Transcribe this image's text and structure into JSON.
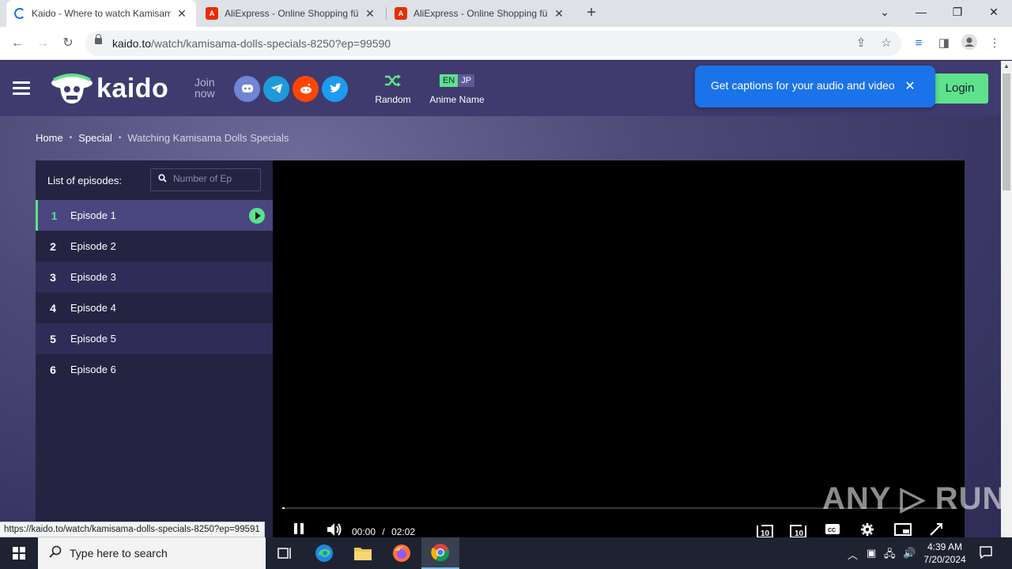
{
  "browser": {
    "tabs": [
      {
        "title": "Kaido - Where to watch Kamisama",
        "close": "✕"
      },
      {
        "title": "AliExpress - Online Shopping für",
        "close": "✕"
      },
      {
        "title": "AliExpress - Online Shopping für",
        "close": "✕"
      }
    ],
    "new_tab": "+",
    "url_host": "kaido.to",
    "url_path": "/watch/kamisama-dolls-specials-8250?ep=99590",
    "status_url": "https://kaido.to/watch/kamisama-dolls-specials-8250?ep=99591"
  },
  "header": {
    "logo_text": "kaido",
    "join_line1": "Join",
    "join_line2": "now",
    "random_label": "Random",
    "anime_name_label": "Anime Name",
    "lang_en": "EN",
    "lang_jp": "JP",
    "login_label": "Login"
  },
  "caption_popup": {
    "text": "Get captions for your audio and video",
    "close": "✕"
  },
  "breadcrumb": {
    "home": "Home",
    "category": "Special",
    "current": "Watching Kamisama Dolls Specials",
    "separator": "•"
  },
  "episodes": {
    "header_label": "List of episodes:",
    "search_placeholder": "Number of Ep",
    "items": [
      {
        "number": "1",
        "title": "Episode 1"
      },
      {
        "number": "2",
        "title": "Episode 2"
      },
      {
        "number": "3",
        "title": "Episode 3"
      },
      {
        "number": "4",
        "title": "Episode 4"
      },
      {
        "number": "5",
        "title": "Episode 5"
      },
      {
        "number": "6",
        "title": "Episode 6"
      }
    ]
  },
  "player": {
    "current_time": "00:00",
    "separator": "/",
    "duration": "02:02",
    "progress": 0.0,
    "rewind_label": "10",
    "forward_label": "10",
    "cc_label": "CC"
  },
  "watermark": "ANY ▷ RUN",
  "taskbar": {
    "search_placeholder": "Type here to search",
    "time": "4:39 AM",
    "date": "7/20/2024"
  },
  "colors": {
    "accent_green": "#5ee28c",
    "header_purple": "#3f3b6f",
    "chrome_blue": "#1a73e8"
  }
}
